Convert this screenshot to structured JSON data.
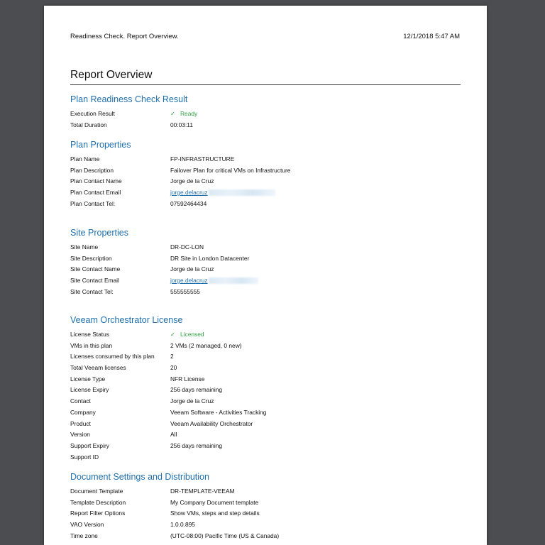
{
  "header": {
    "left": "Readiness Check. Report Overview.",
    "right": "12/1/2018 5:47 AM"
  },
  "title": "Report Overview",
  "plan_check": {
    "title": "Plan Readiness Check Result",
    "rows": [
      {
        "k": "Execution Result",
        "v": "Ready"
      },
      {
        "k": "Total Duration",
        "v": "00:03:11"
      }
    ]
  },
  "plan_props": {
    "title": "Plan Properties",
    "rows": [
      {
        "k": "Plan Name",
        "v": "FP-INFRASTRUCTURE"
      },
      {
        "k": "Plan Description",
        "v": "Failover Plan for critical VMs on Infrastructure"
      },
      {
        "k": "Plan Contact Name",
        "v": "Jorge de la Cruz"
      },
      {
        "k": "Plan Contact Email",
        "v": "jorge.delacruz"
      },
      {
        "k": "Plan Contact Tel:",
        "v": "07592464434"
      }
    ]
  },
  "site_props": {
    "title": "Site Properties",
    "rows": [
      {
        "k": "Site Name",
        "v": "DR-DC-LON"
      },
      {
        "k": "Site Description",
        "v": "DR Site in London Datacenter"
      },
      {
        "k": "Site Contact Name",
        "v": "Jorge de la Cruz"
      },
      {
        "k": "Site Contact Email",
        "v": "jorge.delacruz"
      },
      {
        "k": "Site Contact Tel:",
        "v": "555555555"
      }
    ]
  },
  "license": {
    "title": "Veeam Orchestrator License",
    "rows": [
      {
        "k": "License Status",
        "v": "Licensed"
      },
      {
        "k": "VMs in this plan",
        "v": "2 VMs (2 managed, 0 new)"
      },
      {
        "k": "Licenses consumed by this plan",
        "v": "2"
      },
      {
        "k": "Total Veeam licenses",
        "v": "20"
      },
      {
        "k": "License Type",
        "v": "NFR License"
      },
      {
        "k": "License Expiry",
        "v": "256 days remaining"
      },
      {
        "k": "Contact",
        "v": "Jorge de la Cruz"
      },
      {
        "k": "Company",
        "v": "Veeam Software - Activities Tracking"
      },
      {
        "k": "Product",
        "v": "Veeam Availability Orchestrator"
      },
      {
        "k": "Version",
        "v": "All"
      },
      {
        "k": "Support Expiry",
        "v": "256 days remaining"
      },
      {
        "k": "Support ID",
        "v": ""
      }
    ]
  },
  "doc_settings": {
    "title": "Document Settings and Distribution",
    "rows": [
      {
        "k": "Document Template",
        "v": "DR-TEMPLATE-VEEAM"
      },
      {
        "k": "Template Description",
        "v": "My Company Document template"
      },
      {
        "k": "Report Filter Options",
        "v": "Show VMs, steps and step details"
      },
      {
        "k": "VAO Version",
        "v": "1.0.0.895"
      },
      {
        "k": "Time zone",
        "v": "(UTC-08:00) Pacific Time (US & Canada)"
      }
    ]
  },
  "icons": {
    "check": "check-icon"
  },
  "colors": {
    "heading": "#1f6fad",
    "ok": "#2ea043",
    "background": "#4b4d50"
  }
}
